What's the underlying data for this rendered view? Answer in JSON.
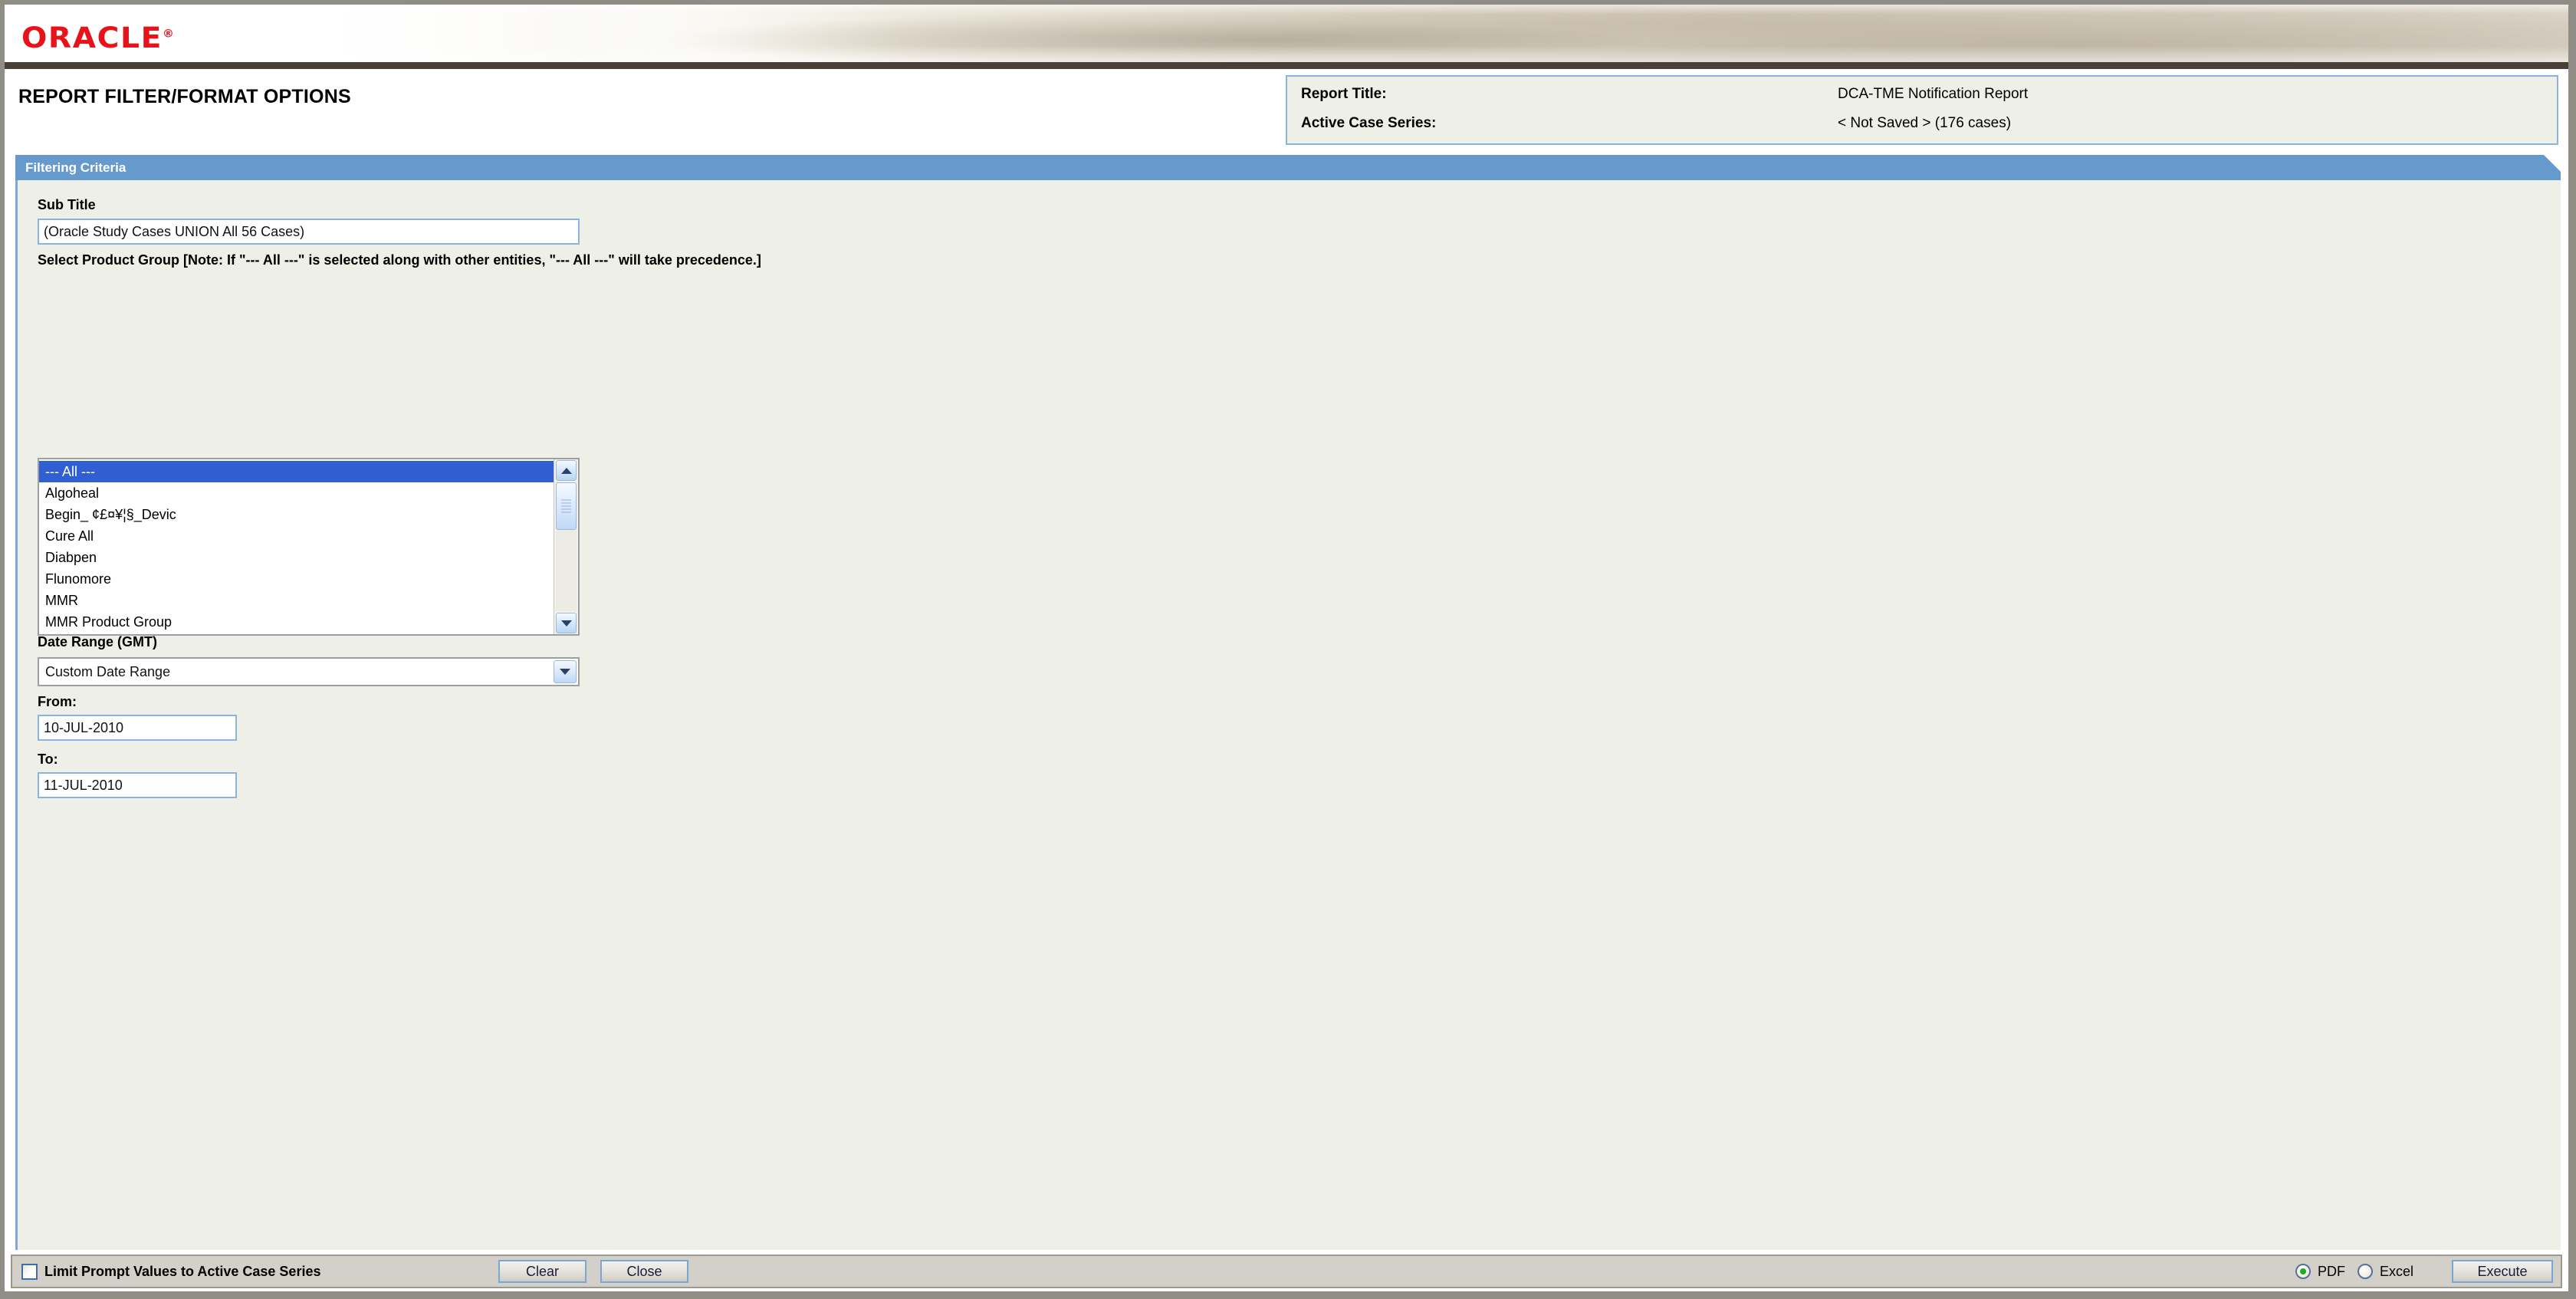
{
  "window": {
    "brand": "ORACLE",
    "brand_tm": "®",
    "brand_color": "#e8131a"
  },
  "header": {
    "page_title": "REPORT FILTER/FORMAT OPTIONS",
    "report_info": {
      "title_label": "Report Title:",
      "title_value": "DCA-TME Notification Report",
      "series_label": "Active Case Series:",
      "series_value": "< Not Saved > (176 cases)"
    }
  },
  "section": {
    "filtering_criteria_label": "Filtering Criteria",
    "accent_color": "#6699cc"
  },
  "form": {
    "sub_title": {
      "label": "Sub Title",
      "value": "(Oracle Study Cases UNION All 56 Cases)",
      "placeholder": ""
    },
    "product_group": {
      "label": "Select Product Group [Note: If \"--- All ---\" is selected along with other entities, \"--- All ---\" will take precedence.]",
      "options": [
        {
          "label": "--- All ---",
          "selected": true
        },
        {
          "label": "Algoheal",
          "selected": false
        },
        {
          "label": "Begin_  ¢£¤¥¦§_Devic",
          "selected": false
        },
        {
          "label": "Cure All",
          "selected": false
        },
        {
          "label": "Diabpen",
          "selected": false
        },
        {
          "label": "Flunomore",
          "selected": false
        },
        {
          "label": "MMR",
          "selected": false
        },
        {
          "label": "MMR Product Group",
          "selected": false
        }
      ],
      "selection_color": "#2f5fd0"
    },
    "date_range": {
      "label": "Date Range (GMT)",
      "selected_option": "Custom Date Range"
    },
    "from": {
      "label": "From:",
      "value": "10-JUL-2010",
      "placeholder": ""
    },
    "to": {
      "label": "To:",
      "value": "11-JUL-2010",
      "placeholder": ""
    }
  },
  "toolbar": {
    "limit_prompt_label": "Limit Prompt Values to Active Case Series",
    "limit_prompt_checked": false,
    "clear_label": "Clear",
    "close_label": "Close",
    "format_pdf_label": "PDF",
    "format_excel_label": "Excel",
    "format_selected": "PDF",
    "execute_label": "Execute",
    "selected_radio_color": "#1faa22"
  }
}
